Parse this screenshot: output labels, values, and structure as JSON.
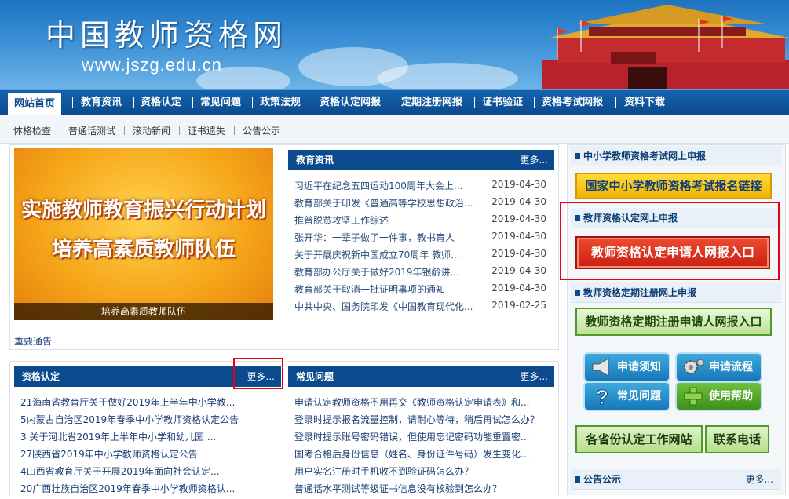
{
  "header": {
    "site_name": "中国教师资格网",
    "site_url": "www.jszg.edu.cn"
  },
  "nav": {
    "items": [
      "网站首页",
      "教育资讯",
      "资格认定",
      "常见问题",
      "政策法规",
      "资格认定网报",
      "定期注册网报",
      "证书验证",
      "资格考试网报",
      "资料下载"
    ],
    "active_index": 0
  },
  "subnav": {
    "items": [
      "体格检查",
      "普通话测试",
      "滚动新闻",
      "证书遗失",
      "公告公示"
    ]
  },
  "promo": {
    "line1": "实施教师教育振兴行动计划",
    "line2": "培养高素质教师队伍",
    "caption": "培养高素质教师队伍",
    "notice_link": "重要通告"
  },
  "news": {
    "title": "教育资讯",
    "more": "更多...",
    "items": [
      {
        "title": "习近平在纪念五四运动100周年大会上...",
        "date": "2019-04-30"
      },
      {
        "title": "教育部关于印发《普通高等学校思想政治...",
        "date": "2019-04-30"
      },
      {
        "title": "推普脱贫攻坚工作综述",
        "date": "2019-04-30"
      },
      {
        "title": "张开华：一辈子做了一件事，教书育人",
        "date": "2019-04-30"
      },
      {
        "title": "关于开展庆祝新中国成立70周年 教师...",
        "date": "2019-04-30"
      },
      {
        "title": "教育部办公厅关于做好2019年银龄讲...",
        "date": "2019-04-30"
      },
      {
        "title": "教育部关于取消一批证明事项的通知",
        "date": "2019-04-30"
      },
      {
        "title": "中共中央、国务院印发《中国教育现代化...",
        "date": "2019-02-25"
      }
    ]
  },
  "certification": {
    "title": "资格认定",
    "more": "更多...",
    "items": [
      "21海南省教育厅关于做好2019年上半年中小学教...",
      "5内蒙古自治区2019年春季中小学教师资格认定公告",
      "3 关于河北省2019年上半年中小学和幼儿园 ...",
      "27陕西省2019年中小学教师资格认定公告",
      "4山西省教育厅关于开展2019年面向社会认定...",
      "20广西壮族自治区2019年春季中小学教师资格认..."
    ]
  },
  "faq": {
    "title": "常见问题",
    "more": "更多...",
    "items": [
      "申请认定教师资格不用再交《教师资格认定申请表》和...",
      "登录时提示报名流量控制，请耐心等待，稍后再试怎么办？",
      "登录时提示账号密码错误，但使用忘记密码功能重置密...",
      "国考合格后身份信息（姓名、身份证件号码）发生变化...",
      "用户实名注册时手机收不到验证码怎么办？",
      "普通话水平测试等级证书信息没有核验到怎么办？"
    ]
  },
  "sidebar": {
    "exam": {
      "title": "中小学教师资格考试网上申报",
      "button": "国家中小学教师资格考试报名链接"
    },
    "cert": {
      "title": "教师资格认定网上申报",
      "button": "教师资格认定申请人网报入口"
    },
    "renew": {
      "title": "教师资格定期注册网上申报",
      "button": "教师资格定期注册申请人网报入口"
    },
    "icons": [
      "申请须知",
      "申请流程",
      "常见问题",
      "使用帮助"
    ],
    "province_sites": "各省份认定工作网站",
    "contact": "联系电话",
    "notice": {
      "title": "公告公示",
      "more": "更多..."
    }
  },
  "colors": {
    "nav_blue": "#0b4a8c",
    "highlight_red": "#e60012",
    "exam_button": "#f5c518",
    "cert_button": "#d9281b",
    "renew_button": "#4f9b2a"
  }
}
